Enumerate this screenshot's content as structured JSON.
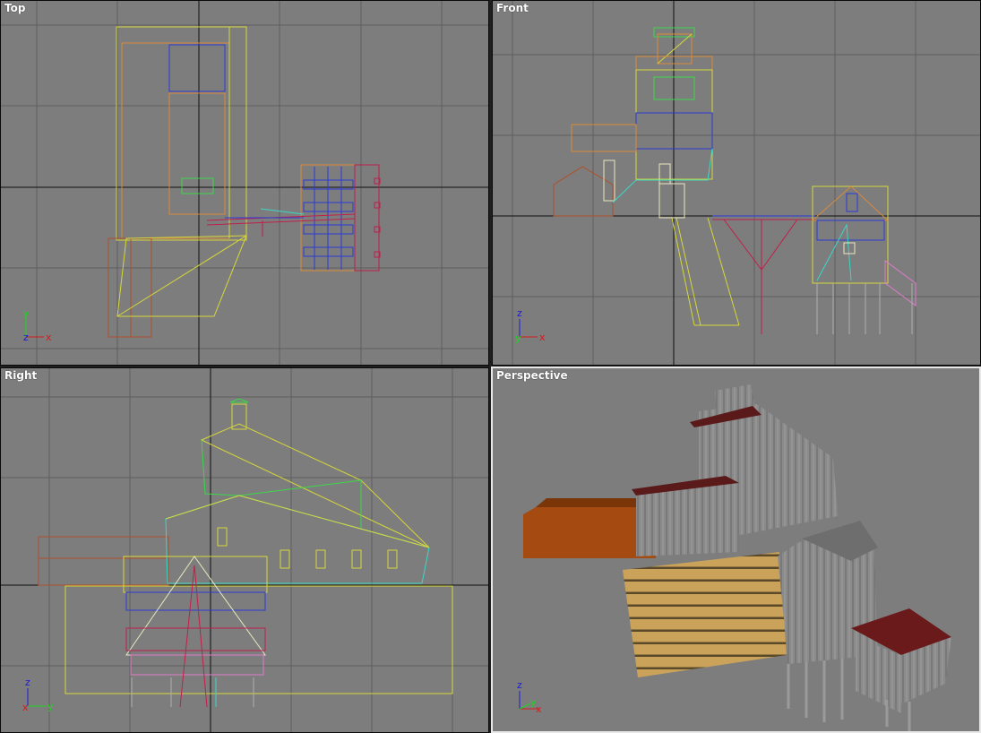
{
  "viewports": {
    "top": {
      "label": "Top",
      "axis_v": "y",
      "axis_h": "x",
      "axis_o": "z"
    },
    "front": {
      "label": "Front",
      "axis_v": "z",
      "axis_h": "x",
      "axis_o": "y"
    },
    "right": {
      "label": "Right",
      "axis_v": "z",
      "axis_h": "y",
      "axis_o": "x"
    },
    "persp": {
      "label": "Perspective",
      "axis_v": "z",
      "axis_h": "x",
      "axis_o": "y"
    }
  },
  "colors": {
    "viewport_bg": "#7d7d7d",
    "grid": "#5e5e5e",
    "grid_axis": "#101010",
    "wire_yellow": "#d7d73a",
    "wire_orange": "#d98a3a",
    "wire_green": "#3ad84a",
    "wire_cyan": "#3ad8c8",
    "wire_blue": "#2a3ad8",
    "wire_red": "#c0204a",
    "wire_pink": "#e07ac8",
    "wire_brown": "#8a3a1a",
    "axis_x": "#d81a1a",
    "axis_y": "#1ad81a",
    "axis_z": "#1a1ad8"
  },
  "icons": [
    "axis-tripod-icon"
  ]
}
